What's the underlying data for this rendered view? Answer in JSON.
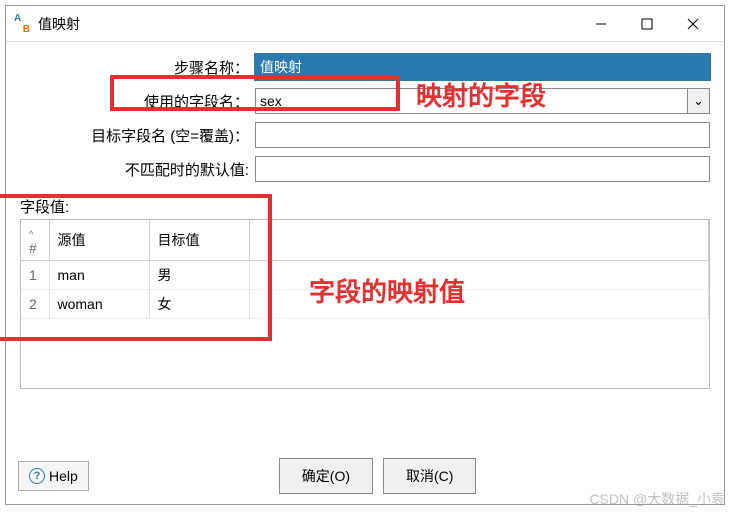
{
  "window": {
    "title": "值映射"
  },
  "form": {
    "step_name_label": "步骤名称：",
    "step_name_value": "值映射",
    "field_name_label": "使用的字段名：",
    "field_name_value": "sex",
    "target_field_label": "目标字段名 (空=覆盖)：",
    "target_field_value": "",
    "default_label": "不匹配时的默认值:",
    "default_value": ""
  },
  "annotations": {
    "mapped_field": "映射的字段",
    "mapped_values": "字段的映射值"
  },
  "table": {
    "section_label": "字段值:",
    "headers": {
      "idx": "#",
      "src": "源值",
      "tgt": "目标值"
    },
    "rows": [
      {
        "idx": "1",
        "src": "man",
        "tgt": "男"
      },
      {
        "idx": "2",
        "src": "woman",
        "tgt": "女"
      }
    ]
  },
  "footer": {
    "help": "Help",
    "ok": "确定(O)",
    "cancel": "取消(C)"
  },
  "watermark": "CSDN @大数据_小袁"
}
